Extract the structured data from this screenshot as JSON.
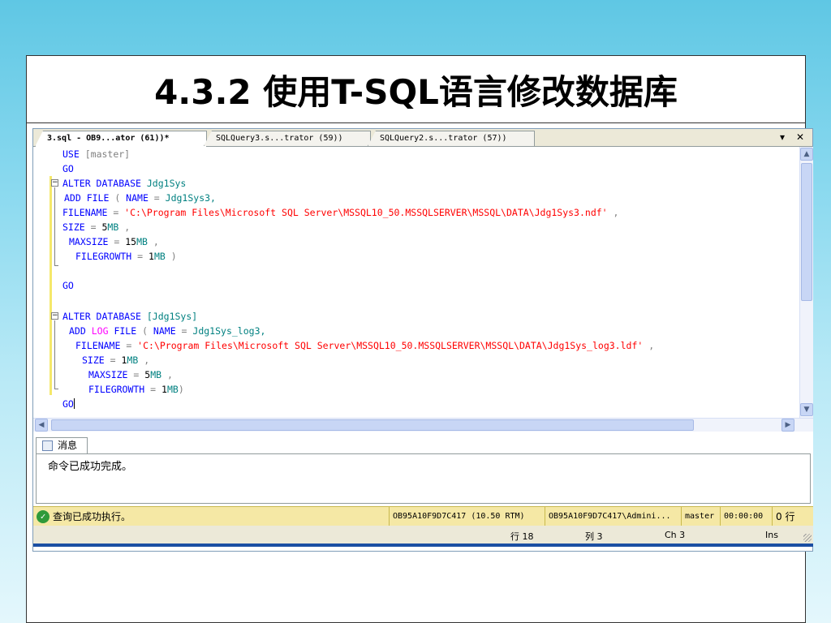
{
  "slide": {
    "title": "4.3.2  使用T-SQL语言修改数据库"
  },
  "tabs": [
    {
      "label": "3.sql - OB9...ator (61))*",
      "active": true
    },
    {
      "label": "SQLQuery3.s...trator (59))",
      "active": false
    },
    {
      "label": "SQLQuery2.s...trator (57))",
      "active": false
    }
  ],
  "tab_controls": {
    "dropdown": "▾",
    "close": "✕"
  },
  "code": {
    "l1": {
      "kw": "USE",
      "rest": "[master]"
    },
    "l2": {
      "kw": "GO"
    },
    "l3": {
      "kw": "ALTER DATABASE",
      "name": "Jdg1Sys"
    },
    "l4": {
      "kw": "ADD FILE",
      "p1": " ( ",
      "k2": "NAME",
      "p2": " = ",
      "val": "Jdg1Sys3,"
    },
    "l5": {
      "kw": "FILENAME",
      "p1": " = ",
      "str": "'C:\\Program Files\\Microsoft SQL Server\\MSSQL10_50.MSSQLSERVER\\MSSQL\\DATA\\Jdg1Sys3.ndf'",
      "p2": " ,"
    },
    "l6": {
      "kw": "SIZE",
      "p1": " = ",
      "num": "5",
      "unit": "MB",
      "p2": " ,"
    },
    "l7": {
      "kw": "MAXSIZE",
      "p1": " = ",
      "num": "15",
      "unit": "MB",
      "p2": " ,"
    },
    "l8": {
      "kw": "FILEGROWTH",
      "p1": " = ",
      "num": "1",
      "unit": "MB",
      "p2": " )"
    },
    "l9": {
      "kw": "GO"
    },
    "l10": {
      "kw": "ALTER DATABASE",
      "name": "[Jdg1Sys]"
    },
    "l11": {
      "kw": "ADD",
      "kw2": "LOG",
      "kw3": "FILE",
      "p1": " ( ",
      "k2": "NAME",
      "p2": " = ",
      "val": "Jdg1Sys_log3,"
    },
    "l12": {
      "kw": "FILENAME",
      "p1": " = ",
      "str": "'C:\\Program Files\\Microsoft SQL Server\\MSSQL10_50.MSSQLSERVER\\MSSQL\\DATA\\Jdg1Sys_log3.ldf'",
      "p2": " ,"
    },
    "l13": {
      "kw": "SIZE",
      "p1": " = ",
      "num": "1",
      "unit": "MB",
      "p2": " ,"
    },
    "l14": {
      "kw": "MAXSIZE",
      "p1": " = ",
      "num": "5",
      "unit": "MB",
      "p2": " ,"
    },
    "l15": {
      "kw": "FILEGROWTH",
      "p1": " = ",
      "num": "1",
      "unit": "MB",
      "p2": ")"
    },
    "l16": {
      "kw": "GO"
    }
  },
  "results": {
    "tab_label": "消息",
    "message": "命令已成功完成。"
  },
  "status": {
    "message": "查询已成功执行。",
    "server": "OB95A10F9D7C417 (10.50 RTM)",
    "user": "OB95A10F9D7C417\\Admini...",
    "database": "master",
    "time": "00:00:00",
    "rows": "0 行"
  },
  "position": {
    "line": "行 18",
    "col": "列 3",
    "ch": "Ch 3",
    "mode": "Ins"
  },
  "colors": {
    "keyword": "#0000ff",
    "string": "#ff0000",
    "identifier": "#008080",
    "status_bg": "#f5e8a5",
    "accent": "#1b4fa3"
  }
}
